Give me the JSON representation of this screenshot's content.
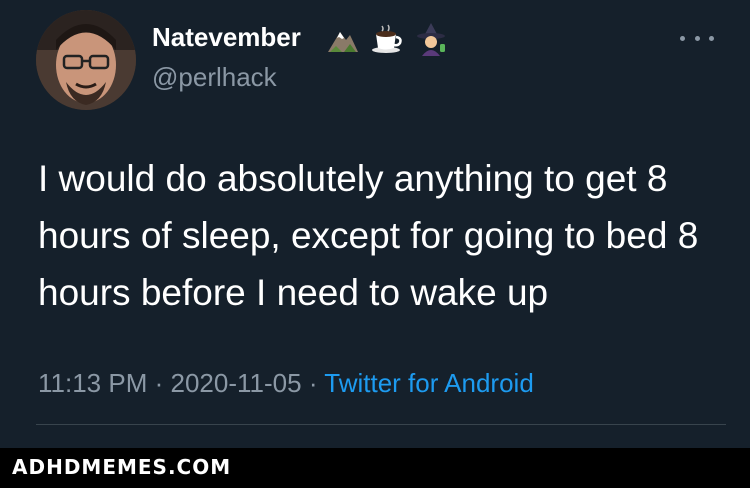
{
  "user": {
    "display_name": "Natevember",
    "handle": "@perlhack",
    "name_emojis": [
      "mountain-icon",
      "coffee-icon",
      "witch-icon"
    ]
  },
  "tweet": {
    "text": "I would do absolutely anything to get 8 hours of sleep, except for going to bed 8 hours before I need to wake up",
    "time": "11:13 PM",
    "separator": "·",
    "date": "2020-11-05",
    "source": "Twitter for Android"
  },
  "footer": {
    "watermark": "ADHDMEMES.COM"
  },
  "colors": {
    "background": "#15202b",
    "text_primary": "#ffffff",
    "text_secondary": "#8b98a5",
    "link": "#1d9bf0",
    "footer_bg": "#000000"
  }
}
